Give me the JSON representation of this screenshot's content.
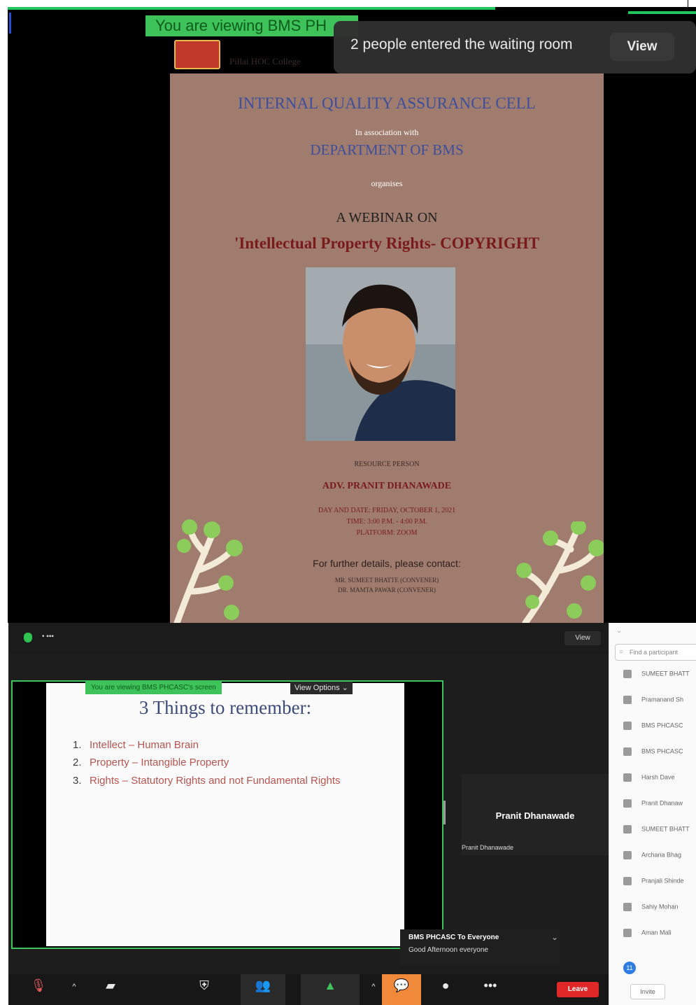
{
  "top_share": {
    "viewing_banner": "You are viewing BMS PH",
    "notification": {
      "text": "2 people entered the waiting room",
      "view_label": "View"
    },
    "poster": {
      "college_name": "Pillai HOC College",
      "line1": "INTERNAL QUALITY ASSURANCE CELL",
      "line2": "In association with",
      "line3": "DEPARTMENT OF BMS",
      "line4": "organises",
      "line5": "A WEBINAR ON",
      "line6": "'Intellectual Property Rights- COPYRIGHT",
      "resource_label": "RESOURCE PERSON",
      "resource_name": "ADV. PRANIT DHANAWADE",
      "details1": "DAY AND DATE: FRIDAY, OCTOBER 1, 2021",
      "details2": "TIME: 3:00 P.M. - 4:00 P.M.",
      "details3": "PLATFORM: ZOOM",
      "contact_heading": "For further details, please contact:",
      "contact1": "MR. SUMEET BHATTE (CONVENER)",
      "contact2": "DR. MAMTA PAWAR (CONVENER)"
    }
  },
  "bottom_meeting": {
    "share_banner": "You are viewing BMS PHCASC's screen",
    "view_options": "View Options ⌄",
    "view_button": "View",
    "slide": {
      "title": "3 Things to remember:",
      "items": [
        {
          "num": "1.",
          "text": "Intellect – Human Brain"
        },
        {
          "num": "2.",
          "text": "Property – Intangible Property"
        },
        {
          "num": "3.",
          "text": "Rights – Statutory Rights and not Fundamental Rights"
        }
      ]
    },
    "video_tile": {
      "name": "Pranit Dhanawade",
      "sub": "Pranit Dhanawade"
    },
    "chat_popup": {
      "from": "BMS PHCASC To Everyone",
      "message": "Good Afternoon everyone"
    },
    "toolbar": {
      "end_label": "Leave"
    }
  },
  "participants_panel": {
    "search_placeholder": "Find a participant",
    "rows": [
      "SUMEET BHATT",
      "Pramanand Sh",
      "BMS PHCASC",
      "BMS PHCASC",
      "Harsh Dave",
      "Pranit Dhanaw",
      "SUMEET BHATT",
      "Archana Bhag",
      "Pranjali Shinde",
      "Sahiy Mohan",
      "Aman Mali"
    ],
    "badge": "11",
    "invite_label": "Invite"
  },
  "colors": {
    "share_green": "#3ec25a",
    "poster_bg": "#a07c6e",
    "end_red": "#e02828",
    "chat_orange": "#f08a3a"
  }
}
